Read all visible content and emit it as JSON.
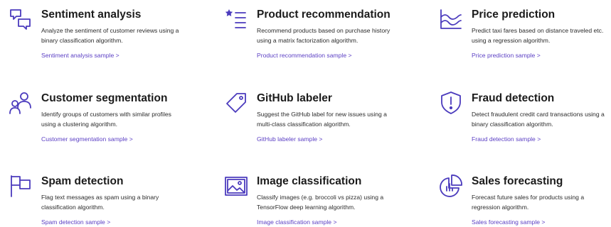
{
  "cards": [
    {
      "title": "Sentiment analysis",
      "description": "Analyze the sentiment of customer reviews using a binary classification algorithm.",
      "link": "Sentiment analysis sample >",
      "icon": "chat-bubbles-icon"
    },
    {
      "title": "Product recommendation",
      "description": "Recommend products based on purchase history using a matrix factorization algorithm.",
      "link": "Product recommendation sample >",
      "icon": "star-list-icon"
    },
    {
      "title": "Price prediction",
      "description": "Predict taxi fares based on distance traveled etc. using a regression algorithm.",
      "link": "Price prediction sample >",
      "icon": "line-chart-icon"
    },
    {
      "title": "Customer segmentation",
      "description": "Identify groups of customers with similar profiles using a clustering algorithm.",
      "link": "Customer segmentation sample >",
      "icon": "people-icon"
    },
    {
      "title": "GitHub labeler",
      "description": "Suggest the GitHub label for new issues using a multi-class classification algorithm.",
      "link": "GitHub labeler sample >",
      "icon": "tag-icon"
    },
    {
      "title": "Fraud detection",
      "description": "Detect fraudulent credit card transactions using a binary classification algorithm.",
      "link": "Fraud detection sample >",
      "icon": "shield-alert-icon"
    },
    {
      "title": "Spam detection",
      "description": "Flag text messages as spam using a binary classification algorithm.",
      "link": "Spam detection sample >",
      "icon": "flag-icon"
    },
    {
      "title": "Image classification",
      "description": "Classify images (e.g. broccoli vs pizza) using a TensorFlow deep learning algorithm.",
      "link": "Image classification sample >",
      "icon": "image-icon"
    },
    {
      "title": "Sales forecasting",
      "description": "Forecast future sales for products using a regression algorithm.",
      "link": "Sales forecasting sample >",
      "icon": "pie-chart-icon"
    }
  ],
  "colors": {
    "accent": "#5b3fc4",
    "text": "#1b1b1b"
  }
}
